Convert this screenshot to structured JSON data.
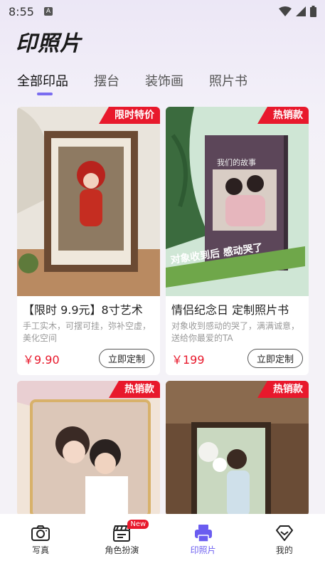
{
  "status_bar": {
    "time": "8:55"
  },
  "app_title": "印照片",
  "tabs": [
    {
      "label": "全部印品",
      "active": true
    },
    {
      "label": "摆台",
      "active": false
    },
    {
      "label": "装饰画",
      "active": false
    },
    {
      "label": "照片书",
      "active": false
    }
  ],
  "products": [
    {
      "badge": "限时特价",
      "title": "【限时 9.9元】8寸艺术",
      "desc": "手工实木，可摆可挂，弥补空虚，美化空间",
      "price": "￥9.90",
      "button": "立即定制"
    },
    {
      "badge": "热销款",
      "title": "情侣纪念日 定制照片书",
      "desc": "对象收到感动的哭了，满满诚意，送给你最爱的TA",
      "price": "￥199",
      "button": "立即定制",
      "book_title": "我们的故事",
      "ribbon": "对象收到后 感动哭了"
    },
    {
      "badge": "热销款"
    },
    {
      "badge": "热销款"
    }
  ],
  "bottom_nav": [
    {
      "label": "写真",
      "icon": "camera-icon"
    },
    {
      "label": "角色扮演",
      "icon": "clapperboard-icon",
      "badge": "New"
    },
    {
      "label": "印照片",
      "icon": "printer-icon",
      "active": true
    },
    {
      "label": "我的",
      "icon": "diamond-icon"
    }
  ],
  "colors": {
    "accent": "#6a5cf0",
    "badge_red": "#e8192c"
  }
}
